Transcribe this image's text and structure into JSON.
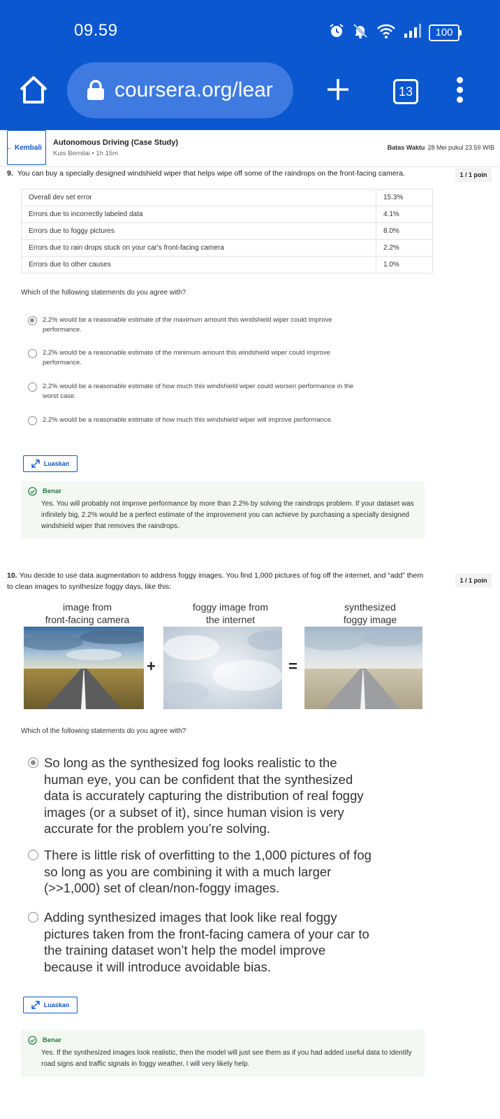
{
  "status": {
    "time": "09.59",
    "battery": "100"
  },
  "browser": {
    "url": "coursera.org/lear",
    "tab_count": "13"
  },
  "course": {
    "back_label": "Kembali",
    "title": "Autonomous Driving (Case Study)",
    "subtitle": "Kuis Bernilai • 1h 15m",
    "deadline_label": "Batas Waktu",
    "deadline_value": "28 Mei pukul 23.59 WIB"
  },
  "q9": {
    "number": "9.",
    "text": "You can buy a specially designed windshield wiper that helps wipe off some of the raindrops on the front-facing camera.",
    "points": "1 / 1 poin",
    "table": [
      {
        "label": "Overall dev set error",
        "value": "15.3%"
      },
      {
        "label": "Errors due to incorrectly labeled data",
        "value": "4.1%"
      },
      {
        "label": "Errors due to foggy pictures",
        "value": "8.0%"
      },
      {
        "label": "Errors due to rain drops stuck on your car's front-facing camera",
        "value": "2.2%"
      },
      {
        "label": "Errors due to other causes",
        "value": "1.0%"
      }
    ],
    "prompt": "Which of the following statements do you agree with?",
    "options": [
      "2.2% would be a reasonable estimate of the maximum amount this windshield wiper could improve performance.",
      "2.2% would be a reasonable estimate of the minimum amount this windshield wiper could improve performance.",
      "2.2% would be a reasonable estimate of how much this windshield wiper could worsen performance in the worst case.",
      "2.2% would be a reasonable estimate of how much this windshield wiper will improve performance."
    ],
    "selected_index": 0,
    "expand_label": "Luaskan",
    "feedback_label": "Benar",
    "feedback_text": "Yes. You will probably not improve performance by more than 2.2% by solving the raindrops problem. If your dataset was infinitely big, 2.2% would be a perfect estimate of the improvement you can achieve by purchasing a specially designed windshield wiper that removes the raindrops."
  },
  "q10": {
    "number": "10.",
    "text": "You decide to use data augmentation to address foggy images. You find 1,000 pictures of fog off the internet, and “add” them to clean images to synthesize foggy days, like this:",
    "points": "1 / 1 poin",
    "figure": {
      "caption1": "image from\nfront-facing camera",
      "caption2": "foggy image from\nthe internet",
      "caption3": "synthesized\nfoggy image",
      "plus": "+",
      "equals": "="
    },
    "prompt": "Which of the following statements do you agree with?",
    "options": [
      "So long as the synthesized fog looks realistic to the human eye, you can be confident that the synthesized data is accurately capturing the distribution of real foggy images (or a subset of it), since human vision is very accurate for the problem you’re solving.",
      "There is little risk of overfitting to the 1,000 pictures of fog so long as you are combining it with a much larger (>>1,000) set of clean/non-foggy images.",
      "Adding synthesized images that look like real foggy pictures taken from the front-facing camera of your car to the training dataset won’t help the model improve because it will introduce avoidable bias."
    ],
    "selected_index": 0,
    "expand_label": "Luaskan",
    "feedback_label": "Benar",
    "feedback_text": "Yes. If the synthesized images look realistic, then the model will just see them as if you had added useful data to identify road signs and traffic signals in foggy weather. I will very likely help."
  }
}
